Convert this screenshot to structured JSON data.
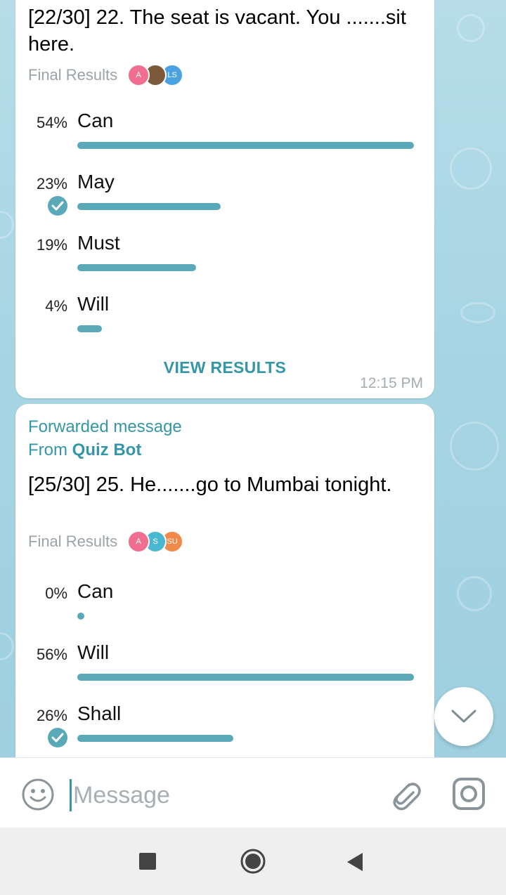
{
  "poll1": {
    "question": "[22/30] 22. The seat is vacant. You .......sit here.",
    "final_label": "Final Results",
    "avatars": [
      {
        "text": "A",
        "color": "#f06e8e"
      },
      {
        "text": "",
        "color": "#7a5a3a"
      },
      {
        "text": "LS",
        "color": "#4aa3e0"
      }
    ],
    "options": [
      {
        "pct": "54%",
        "label": "Can",
        "value": 54,
        "correct": false
      },
      {
        "pct": "23%",
        "label": "May",
        "value": 23,
        "correct": true
      },
      {
        "pct": "19%",
        "label": "Must",
        "value": 19,
        "correct": false
      },
      {
        "pct": "4%",
        "label": "Will",
        "value": 4,
        "correct": false
      }
    ],
    "view_results": "VIEW RESULTS",
    "time": "12:15 PM"
  },
  "poll2": {
    "forwarded": "Forwarded message",
    "from_prefix": "From",
    "from_name": "Quiz Bot",
    "question": "[25/30] 25. He.......go to Mumbai tonight.",
    "final_label": "Final Results",
    "avatars": [
      {
        "text": "A",
        "color": "#f06e8e"
      },
      {
        "text": "S",
        "color": "#4ab8d0"
      },
      {
        "text": "SU",
        "color": "#f08a4a"
      }
    ],
    "options": [
      {
        "pct": "0%",
        "label": "Can",
        "value": 0,
        "correct": false
      },
      {
        "pct": "56%",
        "label": "Will",
        "value": 56,
        "correct": false
      },
      {
        "pct": "26%",
        "label": "Shall",
        "value": 26,
        "correct": true
      }
    ]
  },
  "input": {
    "placeholder": "Message"
  },
  "icons": {
    "emoji": "smiley-icon",
    "attach": "paperclip-icon",
    "camera": "instagram-camera-icon",
    "scroll": "chevron-down-icon"
  },
  "colors": {
    "accent": "#3596a8",
    "bar": "#5aa9b8",
    "chat_bg": "#a9d6e5"
  }
}
